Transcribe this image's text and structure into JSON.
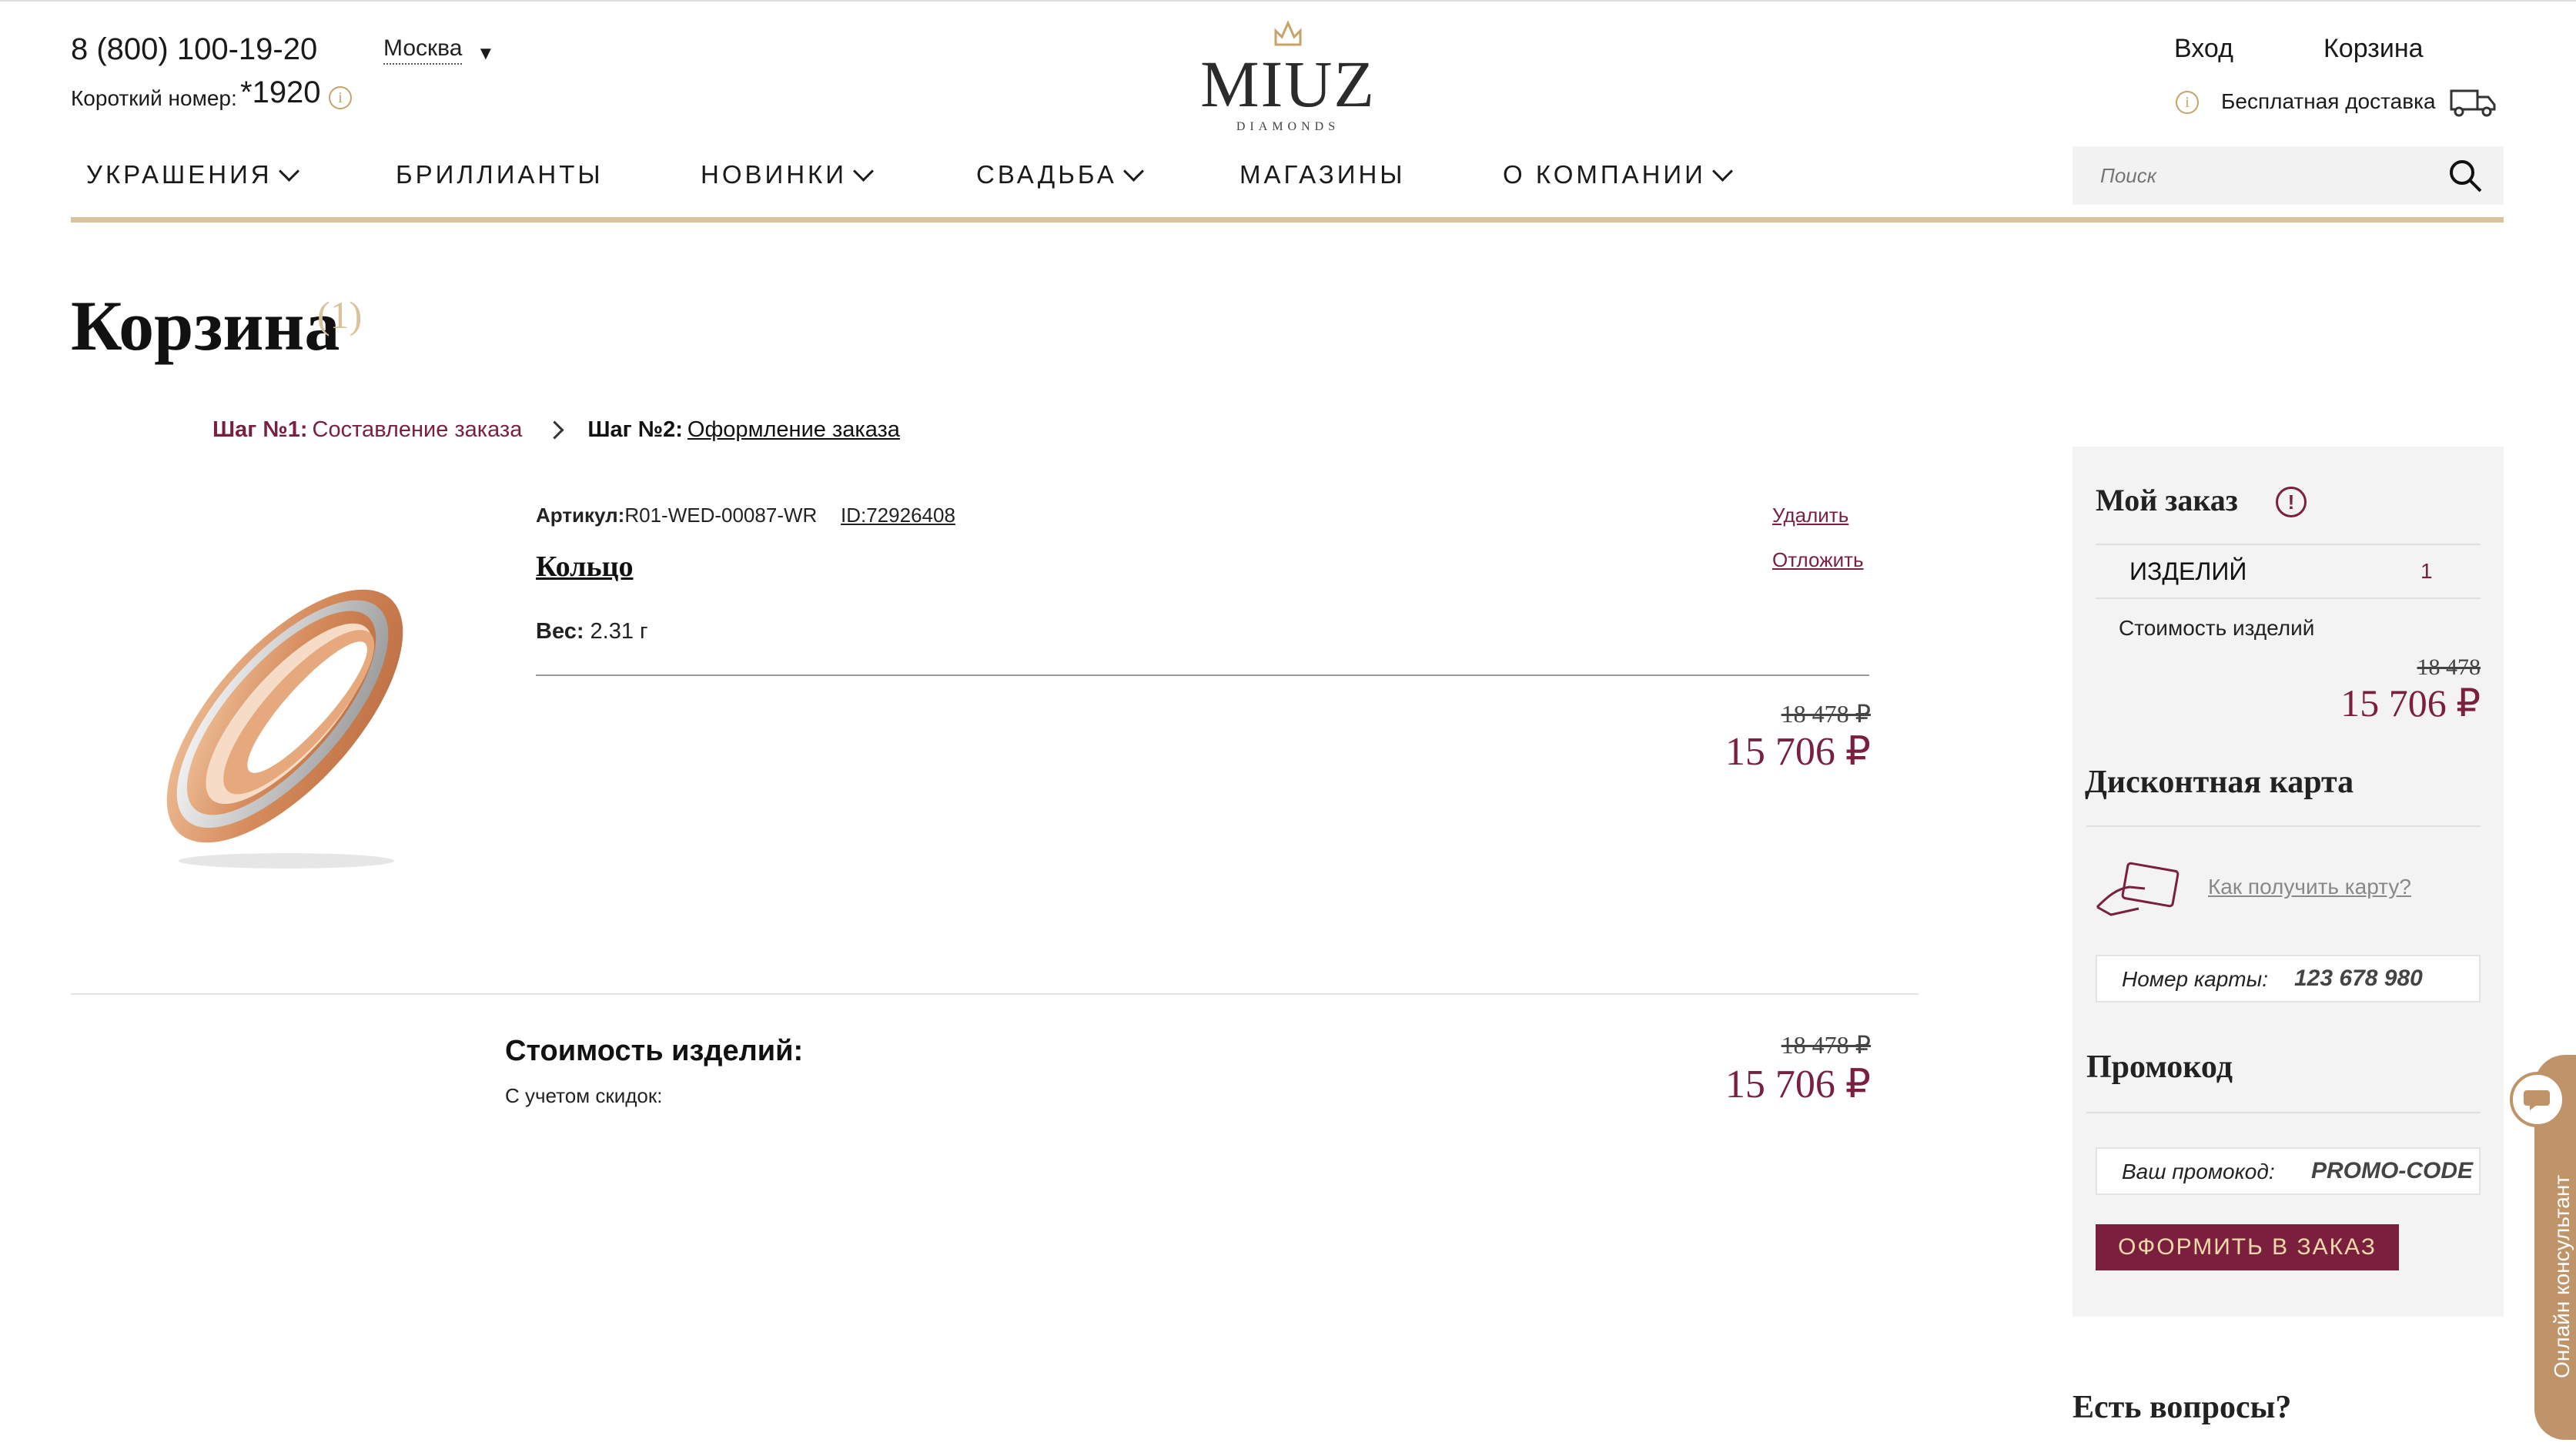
{
  "header": {
    "phone": "8 (800) 100-19-20",
    "city": "Москва",
    "short_label": "Короткий номер:",
    "short_number": "*1920",
    "logo": "MIUZ",
    "logo_sub": "DIAMONDS",
    "login": "Вход",
    "cart": "Корзина",
    "free_delivery": "Бесплатная доставка",
    "search_placeholder": "Поиск"
  },
  "nav": [
    "УКРАШЕНИЯ",
    "БРИЛЛИАНТЫ",
    "НОВИНКИ",
    "СВАДЬБА",
    "МАГАЗИНЫ",
    "О КОМПАНИИ"
  ],
  "page": {
    "title": "Корзина",
    "count": "(1)"
  },
  "steps": {
    "step1_title": "Шаг №1:",
    "step1_label": "Составление заказа",
    "step2_title": "Шаг №2:",
    "step2_label": "Оформление заказа"
  },
  "item": {
    "article_label": "Артикул:",
    "article": "R01-WED-00087-WR",
    "id": "ID:72926408",
    "name": "Кольцо",
    "weight_label": "Вес:",
    "weight": "2.31 г",
    "delete": "Удалить",
    "postpone": "Отложить",
    "old_price": "18 478 ₽",
    "price": "15 706 ₽"
  },
  "summary": {
    "title": "Стоимость изделий:",
    "note": "С учетом скидок:",
    "old_price": "18 478 ₽",
    "price": "15 706 ₽"
  },
  "sidebar": {
    "title": "Мой заказ",
    "items_label": "ИЗДЕЛИЙ",
    "items_count": "1",
    "cost_label": "Стоимость изделий",
    "old_price": "18 478",
    "price": "15 706 ₽",
    "discount_title": "Дисконтная карта",
    "how_to_get": "Как получить карту?",
    "card_label": "Номер карты:",
    "card_value": "123 678 980",
    "promo_title": "Промокод",
    "promo_label": "Ваш промокод:",
    "promo_value": "PROMO-CODE",
    "order_button": "ОФОРМИТЬ В ЗАКАЗ",
    "questions": "Есть вопросы?"
  },
  "consultant": "Онлайн консультант",
  "colors": {
    "accent": "#7b1f3e",
    "gold": "#d8c39d",
    "consultant": "#c09469"
  }
}
